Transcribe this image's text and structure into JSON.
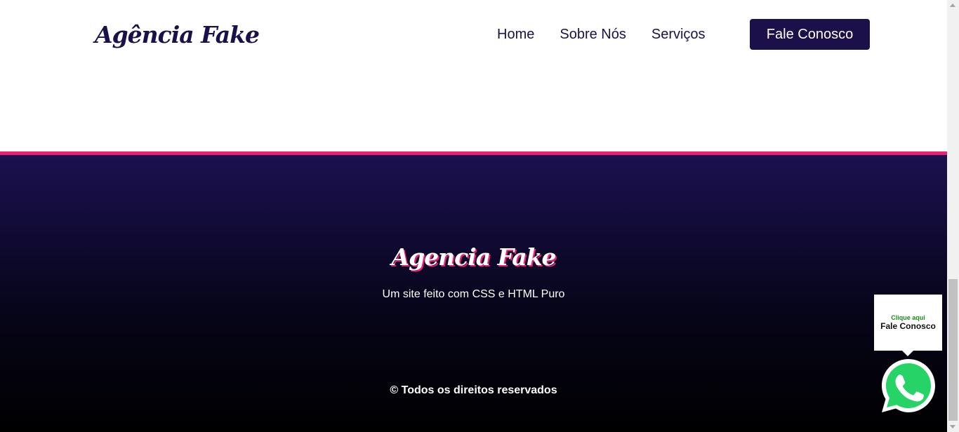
{
  "header": {
    "logo": "Agência Fake",
    "nav": [
      {
        "label": "Home"
      },
      {
        "label": "Sobre Nós"
      },
      {
        "label": "Serviços"
      }
    ],
    "cta_label": "Fale Conosco"
  },
  "footer": {
    "logo": "Agencia Fake",
    "description": "Um site feito com CSS e HTML Puro",
    "copyright": "© Todos os direitos reservados"
  },
  "whatsapp_widget": {
    "small_label": "Clique aqui",
    "big_label": "Fale Conosco",
    "icon": "whatsapp-icon"
  },
  "colors": {
    "brand": "#1b1049",
    "accent": "#ec1f73",
    "whatsapp_green": "#25d366"
  }
}
